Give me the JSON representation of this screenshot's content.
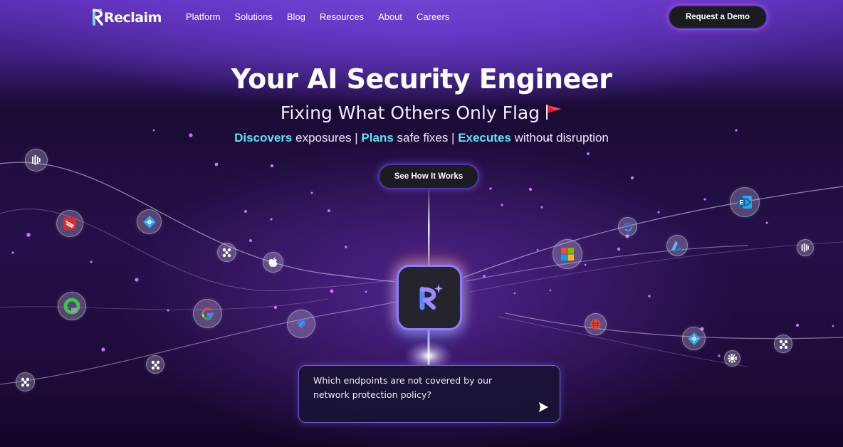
{
  "brand": {
    "name": "Reclaim"
  },
  "nav": {
    "links": [
      "Platform",
      "Solutions",
      "Blog",
      "Resources",
      "About",
      "Careers"
    ],
    "cta": "Request a Demo"
  },
  "hero": {
    "title": "Your AI Security Engineer",
    "subtitle": "Fixing What Others Only Flag",
    "tagline": {
      "w1": "Discovers",
      "t1": " exposures | ",
      "w2": "Plans",
      "t2": " safe fixes | ",
      "w3": "Executes",
      "t3": " without disruption"
    },
    "button": "See How It Works"
  },
  "chat": {
    "prompt": "Which endpoints are not covered by our network protection policy?"
  },
  "colors": {
    "accent_cyan": "#5fe3ee",
    "accent_purple": "#8a7cff",
    "background_top": "#5a2fb4",
    "background_bottom": "#120626"
  },
  "icons": [
    "barcode-icon",
    "red-shield-icon",
    "azure-ad-icon",
    "cluster-icon",
    "apple-icon",
    "green-ring-icon",
    "google-icon",
    "jira-icon",
    "cluster-icon",
    "cluster-icon",
    "exchange-icon",
    "sync-icon",
    "azure-icon",
    "microsoft-icon",
    "barcode-icon",
    "ninja-icon",
    "azure-ad-icon",
    "cluster-icon",
    "gear-icon"
  ]
}
